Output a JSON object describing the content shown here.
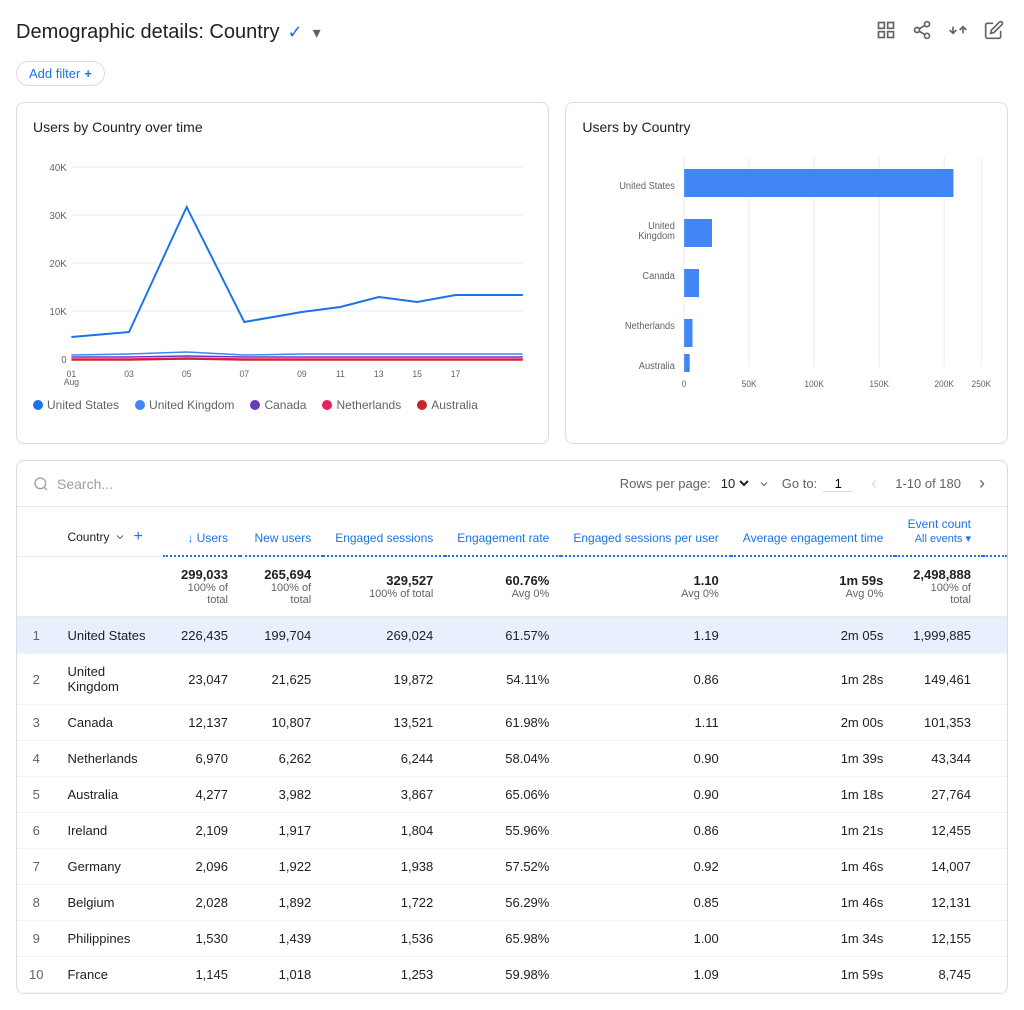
{
  "header": {
    "title": "Demographic details: Country",
    "dropdown_icon": "▾",
    "add_filter_label": "Add filter",
    "icons": [
      "edit-icon",
      "share-icon",
      "compare-icon",
      "pencil-icon"
    ]
  },
  "line_chart": {
    "title": "Users by Country over time",
    "x_labels": [
      "01\nAug",
      "03",
      "05",
      "07",
      "09",
      "11",
      "13",
      "15",
      "17"
    ],
    "y_labels": [
      "40K",
      "30K",
      "20K",
      "10K",
      "0"
    ],
    "legend": [
      {
        "label": "United States",
        "color": "#1a73e8"
      },
      {
        "label": "United Kingdom",
        "color": "#4285f4"
      },
      {
        "label": "Canada",
        "color": "#673ab7"
      },
      {
        "label": "Netherlands",
        "color": "#e91e63"
      },
      {
        "label": "Australia",
        "color": "#c62828"
      }
    ]
  },
  "bar_chart": {
    "title": "Users by Country",
    "x_labels": [
      "0",
      "50K",
      "100K",
      "150K",
      "200K",
      "250K"
    ],
    "bars": [
      {
        "label": "United States",
        "value": 226435,
        "max": 250000
      },
      {
        "label": "United Kingdom",
        "value": 23047,
        "max": 250000
      },
      {
        "label": "Canada",
        "value": 12137,
        "max": 250000
      },
      {
        "label": "Netherlands",
        "value": 6970,
        "max": 250000
      },
      {
        "label": "Australia",
        "value": 4277,
        "max": 250000
      }
    ],
    "bar_color": "#4285f4"
  },
  "table": {
    "search_placeholder": "Search...",
    "rows_per_page_label": "Rows per page:",
    "rows_per_page_value": "10",
    "goto_label": "Go to:",
    "goto_value": "1",
    "page_info": "1-10 of 180",
    "columns": [
      {
        "label": "Country",
        "key": "country",
        "sortable": true
      },
      {
        "label": "↓ Users",
        "key": "users",
        "sortable": true
      },
      {
        "label": "New users",
        "key": "new_users",
        "sortable": true
      },
      {
        "label": "Engaged sessions",
        "key": "engaged_sessions",
        "sortable": true
      },
      {
        "label": "Engagement rate",
        "key": "engagement_rate",
        "sortable": true
      },
      {
        "label": "Engaged sessions per user",
        "key": "engaged_sessions_per_user",
        "sortable": true
      },
      {
        "label": "Average engagement time",
        "key": "avg_engagement_time",
        "sortable": true
      },
      {
        "label": "Event count",
        "key": "event_count",
        "sortable": true,
        "has_dropdown": true,
        "dropdown_label": "All events"
      }
    ],
    "totals": {
      "users": "299,033",
      "users_sub": "100% of total",
      "new_users": "265,694",
      "new_users_sub": "100% of total",
      "engaged_sessions": "329,527",
      "engaged_sessions_sub": "100% of total",
      "engagement_rate": "60.76%",
      "engagement_rate_sub": "Avg 0%",
      "engaged_sessions_per_user": "1.10",
      "engaged_sessions_per_user_sub": "Avg 0%",
      "avg_engagement_time": "1m 59s",
      "avg_engagement_time_sub": "Avg 0%",
      "event_count": "2,498,888",
      "event_count_sub": "100% of total"
    },
    "rows": [
      {
        "rank": 1,
        "country": "United States",
        "users": "226,435",
        "new_users": "199,704",
        "engaged_sessions": "269,024",
        "engagement_rate": "61.57%",
        "engaged_sessions_per_user": "1.19",
        "avg_engagement_time": "2m 05s",
        "event_count": "1,999,885",
        "highlight": true
      },
      {
        "rank": 2,
        "country": "United Kingdom",
        "users": "23,047",
        "new_users": "21,625",
        "engaged_sessions": "19,872",
        "engagement_rate": "54.11%",
        "engaged_sessions_per_user": "0.86",
        "avg_engagement_time": "1m 28s",
        "event_count": "149,461",
        "highlight": false
      },
      {
        "rank": 3,
        "country": "Canada",
        "users": "12,137",
        "new_users": "10,807",
        "engaged_sessions": "13,521",
        "engagement_rate": "61.98%",
        "engaged_sessions_per_user": "1.11",
        "avg_engagement_time": "2m 00s",
        "event_count": "101,353",
        "highlight": false
      },
      {
        "rank": 4,
        "country": "Netherlands",
        "users": "6,970",
        "new_users": "6,262",
        "engaged_sessions": "6,244",
        "engagement_rate": "58.04%",
        "engaged_sessions_per_user": "0.90",
        "avg_engagement_time": "1m 39s",
        "event_count": "43,344",
        "highlight": false
      },
      {
        "rank": 5,
        "country": "Australia",
        "users": "4,277",
        "new_users": "3,982",
        "engaged_sessions": "3,867",
        "engagement_rate": "65.06%",
        "engaged_sessions_per_user": "0.90",
        "avg_engagement_time": "1m 18s",
        "event_count": "27,764",
        "highlight": false
      },
      {
        "rank": 6,
        "country": "Ireland",
        "users": "2,109",
        "new_users": "1,917",
        "engaged_sessions": "1,804",
        "engagement_rate": "55.96%",
        "engaged_sessions_per_user": "0.86",
        "avg_engagement_time": "1m 21s",
        "event_count": "12,455",
        "highlight": false
      },
      {
        "rank": 7,
        "country": "Germany",
        "users": "2,096",
        "new_users": "1,922",
        "engaged_sessions": "1,938",
        "engagement_rate": "57.52%",
        "engaged_sessions_per_user": "0.92",
        "avg_engagement_time": "1m 46s",
        "event_count": "14,007",
        "highlight": false
      },
      {
        "rank": 8,
        "country": "Belgium",
        "users": "2,028",
        "new_users": "1,892",
        "engaged_sessions": "1,722",
        "engagement_rate": "56.29%",
        "engaged_sessions_per_user": "0.85",
        "avg_engagement_time": "1m 46s",
        "event_count": "12,131",
        "highlight": false
      },
      {
        "rank": 9,
        "country": "Philippines",
        "users": "1,530",
        "new_users": "1,439",
        "engaged_sessions": "1,536",
        "engagement_rate": "65.98%",
        "engaged_sessions_per_user": "1.00",
        "avg_engagement_time": "1m 34s",
        "event_count": "12,155",
        "highlight": false
      },
      {
        "rank": 10,
        "country": "France",
        "users": "1,145",
        "new_users": "1,018",
        "engaged_sessions": "1,253",
        "engagement_rate": "59.98%",
        "engaged_sessions_per_user": "1.09",
        "avg_engagement_time": "1m 59s",
        "event_count": "8,745",
        "highlight": false
      }
    ]
  }
}
